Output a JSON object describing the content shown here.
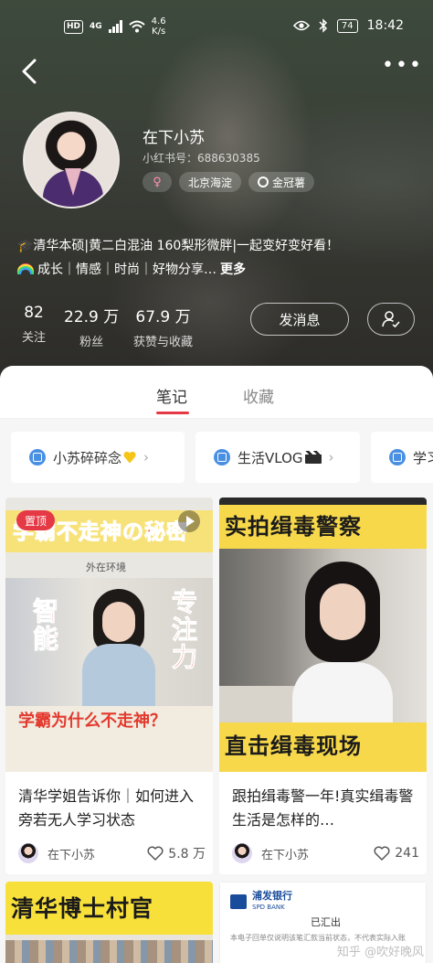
{
  "status_bar": {
    "hd_label": "HD",
    "network_label": "4G",
    "speed_value": "4.6",
    "speed_unit": "K/s",
    "battery_label": "74",
    "time": "18:42"
  },
  "profile": {
    "name": "在下小苏",
    "red_id": "小红书号：688630385",
    "gender_symbol": "♀",
    "location_tag": "北京海淀",
    "honor_tag": "金冠薯",
    "bio_line1": "🎓清华本硕|黄二白混油 160梨形微胖|一起变好变好看！",
    "bio_line2": "成长｜情感｜时尚｜好物分享…",
    "bio_more": "更多",
    "stats": [
      {
        "value": "82",
        "label": "关注"
      },
      {
        "value": "22.9 万",
        "label": "粉丝"
      },
      {
        "value": "67.9 万",
        "label": "获赞与收藏"
      }
    ],
    "message_button": "发消息"
  },
  "tabs": [
    {
      "label": "笔记",
      "active": true
    },
    {
      "label": "收藏",
      "active": false
    }
  ],
  "collections": [
    {
      "label": "小苏碎碎念"
    },
    {
      "label": "生活VLOG"
    },
    {
      "label": "学习"
    }
  ],
  "notes": [
    {
      "pinned_label": "置顶",
      "thumb_headline": "学霸不走神の秘密",
      "thumb_subtitle": "外在环境",
      "thumb_left": "智能",
      "thumb_right": "专注力",
      "thumb_question": "学霸为什么不走神？",
      "title": "清华学姐告诉你｜如何进入旁若无人学习状态",
      "author": "在下小苏",
      "likes": "5.8 万"
    },
    {
      "thumb_headline": "实拍缉毒警察",
      "thumb_bottom": "直击缉毒现场",
      "title": "跟拍缉毒警一年!真实缉毒警生活是怎样的…",
      "author": "在下小苏",
      "likes": "241"
    },
    {
      "thumb_headline": "清华博士村官"
    },
    {
      "bank_name": "浦发银行",
      "bank_name_en": "SPD BANK",
      "doc_title": "已汇出",
      "doc_text": "本电子回单仅说明该笔汇款当前状态，不代表实际入账"
    }
  ],
  "watermark": "知乎 @吹好晚风",
  "colors": {
    "accent": "#e53945",
    "collection_icon": "#4a90e2",
    "thumb_yellow": "#f7d84a"
  }
}
